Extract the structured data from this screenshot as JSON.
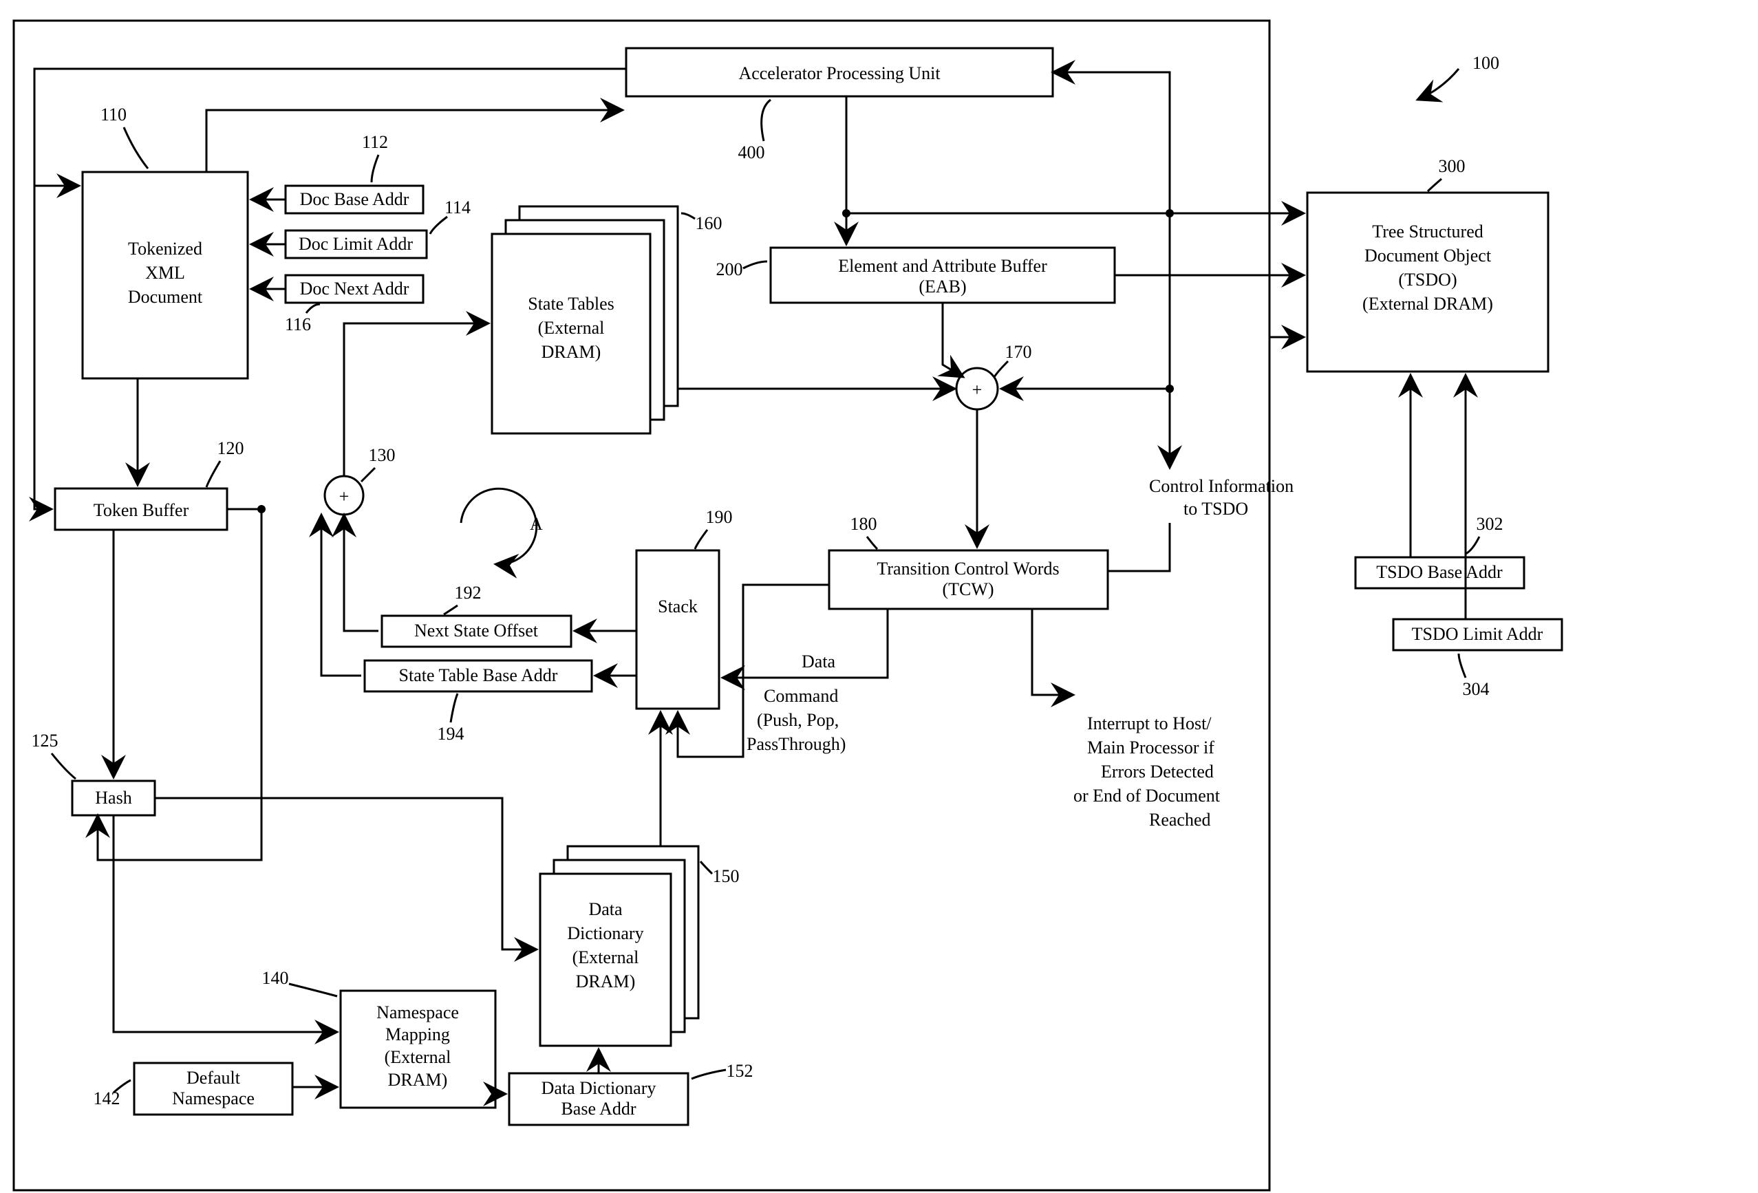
{
  "blocks": {
    "accel": {
      "lines": [
        "Accelerator Processing Unit"
      ]
    },
    "tokenized": {
      "lines": [
        "Tokenized",
        "XML",
        "Document"
      ]
    },
    "docBase": "Doc Base Addr",
    "docLimit": "Doc Limit Addr",
    "docNext": "Doc Next Addr",
    "stateTables": {
      "lines": [
        "State Tables",
        "(External",
        "DRAM)"
      ]
    },
    "eab": {
      "lines": [
        "Element and Attribute Buffer",
        "(EAB)"
      ]
    },
    "tsdo": {
      "lines": [
        "Tree Structured",
        "Document Object",
        "(TSDO)",
        "(External DRAM)"
      ]
    },
    "tsdoBase": "TSDO Base Addr",
    "tsdoLimit": "TSDO Limit Addr",
    "tokenBuffer": "Token Buffer",
    "nextStateOffset": "Next State Offset",
    "stateTableBase": "State Table Base Addr",
    "stack": "Stack",
    "tcw": {
      "lines": [
        "Transition Control Words",
        "(TCW)"
      ]
    },
    "hash": "Hash",
    "dataDict": {
      "lines": [
        "Data",
        "Dictionary",
        "(External",
        "DRAM)"
      ]
    },
    "ddBase": {
      "lines": [
        "Data Dictionary",
        "Base Addr"
      ]
    },
    "nsMap": {
      "lines": [
        "Namespace",
        "Mapping",
        "(External",
        "DRAM)"
      ]
    },
    "default": {
      "lines": [
        "Default",
        "Namespace"
      ]
    }
  },
  "labels": {
    "n100": "100",
    "n110": "110",
    "n112": "112",
    "n114": "114",
    "n116": "116",
    "n120": "120",
    "n125": "125",
    "n130": "130",
    "n140": "140",
    "n142": "142",
    "n150": "150",
    "n152": "152",
    "n160": "160",
    "n170": "170",
    "n180": "180",
    "n190": "190",
    "n192": "192",
    "n194": "194",
    "n200": "200",
    "n300": "300",
    "n302": "302",
    "n304": "304",
    "n400": "400",
    "A": "A",
    "data": "Data",
    "command": {
      "lines": [
        "Command",
        "(Push, Pop,",
        "PassThrough)"
      ]
    },
    "controlInfo": {
      "lines": [
        "Control Information",
        "to TSDO"
      ]
    },
    "interrupt": {
      "lines": [
        "Interrupt to Host/",
        "Main Processor if",
        "Errors Detected",
        "or End of Document",
        "Reached"
      ]
    },
    "plus": "+"
  }
}
